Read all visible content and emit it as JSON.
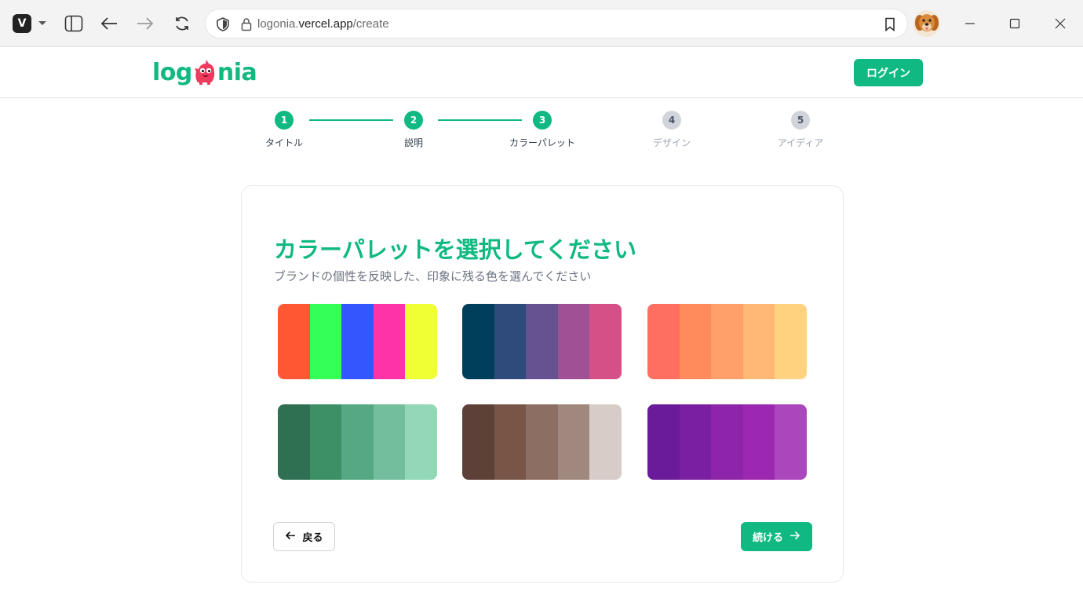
{
  "browser": {
    "url_prefix": "logonia.",
    "url_host": "vercel.app",
    "url_path": "/create"
  },
  "header": {
    "logo_left": "log",
    "logo_right": "nia",
    "login_label": "ログイン"
  },
  "stepper": {
    "steps": [
      {
        "number": "1",
        "label": "タイトル",
        "state": "done"
      },
      {
        "number": "2",
        "label": "説明",
        "state": "done"
      },
      {
        "number": "3",
        "label": "カラーパレット",
        "state": "done"
      },
      {
        "number": "4",
        "label": "デザイン",
        "state": "todo"
      },
      {
        "number": "5",
        "label": "アイディア",
        "state": "todo"
      }
    ]
  },
  "card": {
    "title": "カラーパレットを選択してください",
    "subtitle": "ブランドの個性を反映した、印象に残る色を選んでください",
    "back_label": "戻る",
    "next_label": "続ける"
  },
  "palettes": [
    [
      "#ff5733",
      "#33ff57",
      "#3357ff",
      "#ff33a8",
      "#f0ff33"
    ],
    [
      "#003f5c",
      "#2f4b7c",
      "#665191",
      "#a05195",
      "#d45087"
    ],
    [
      "#ff6f61",
      "#ff8a5c",
      "#ffa06b",
      "#ffb876",
      "#ffd280"
    ],
    [
      "#2e7051",
      "#3d8f66",
      "#56a884",
      "#73be9c",
      "#92d7b6"
    ],
    [
      "#5d4037",
      "#795548",
      "#8d6e63",
      "#a1887f",
      "#d7ccc8"
    ],
    [
      "#6a1b9a",
      "#7b1fa2",
      "#8e24aa",
      "#9c27b0",
      "#ab47bc"
    ]
  ],
  "colors": {
    "accent": "#10b981",
    "inactive": "#d1d5db"
  }
}
